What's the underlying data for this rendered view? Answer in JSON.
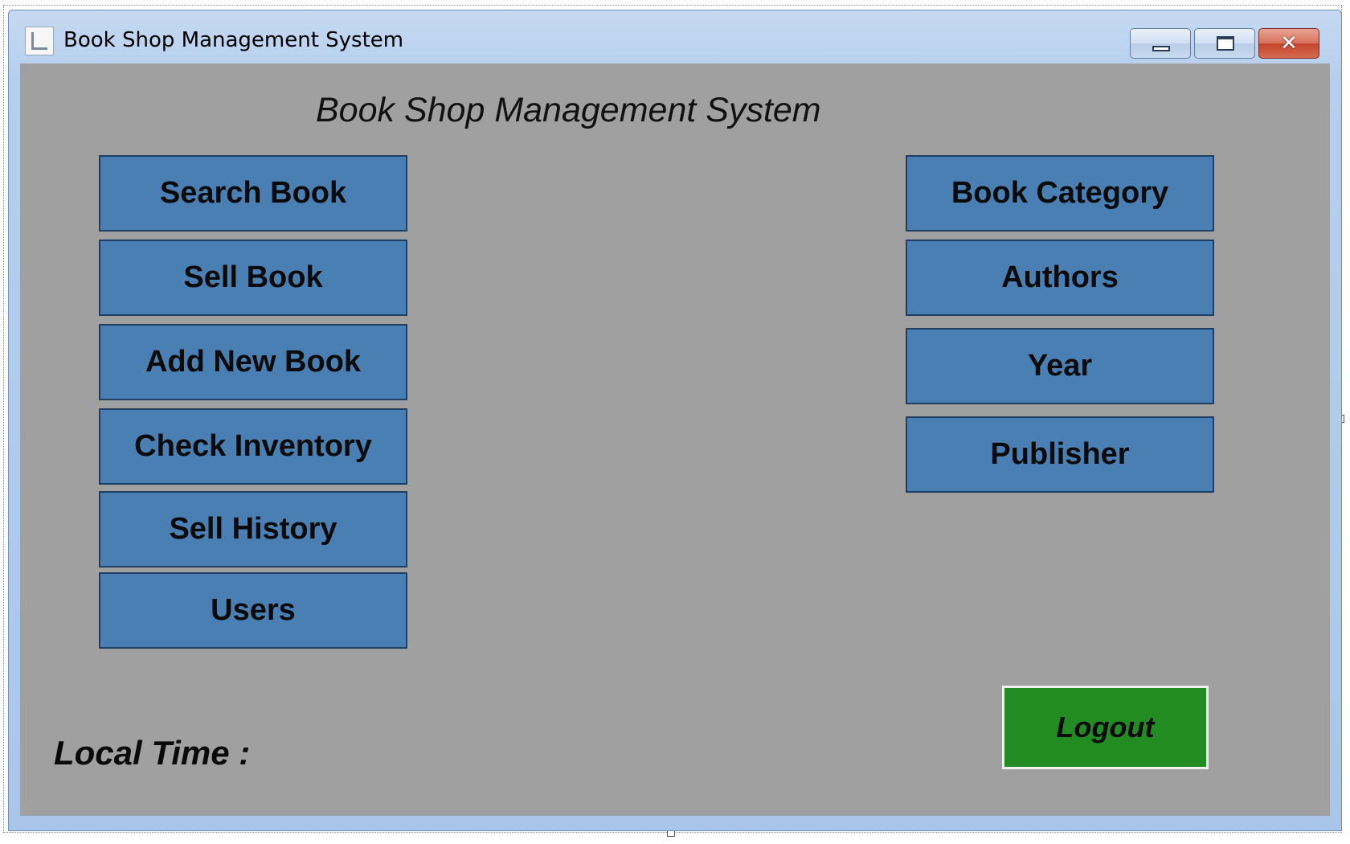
{
  "window": {
    "title": "Book Shop Management System",
    "icon": "app-icon",
    "controls": {
      "minimize_icon": "minimize-icon",
      "maximize_icon": "maximize-icon",
      "close_icon": "close-icon",
      "close_glyph": "✕"
    }
  },
  "form": {
    "heading": "Book Shop Management System",
    "background_color": "#a0a0a0",
    "left_menu": [
      {
        "label": "Search Book"
      },
      {
        "label": "Sell Book"
      },
      {
        "label": "Add New Book"
      },
      {
        "label": "Check Inventory"
      },
      {
        "label": "Sell History"
      },
      {
        "label": "Users"
      }
    ],
    "right_menu": [
      {
        "label": "Book Category"
      },
      {
        "label": "Authors"
      },
      {
        "label": "Year"
      },
      {
        "label": "Publisher"
      }
    ],
    "button_color": "#4a7fb4",
    "logout": {
      "label": "Logout",
      "color": "#228b22"
    },
    "local_time_label": "Local Time :"
  }
}
